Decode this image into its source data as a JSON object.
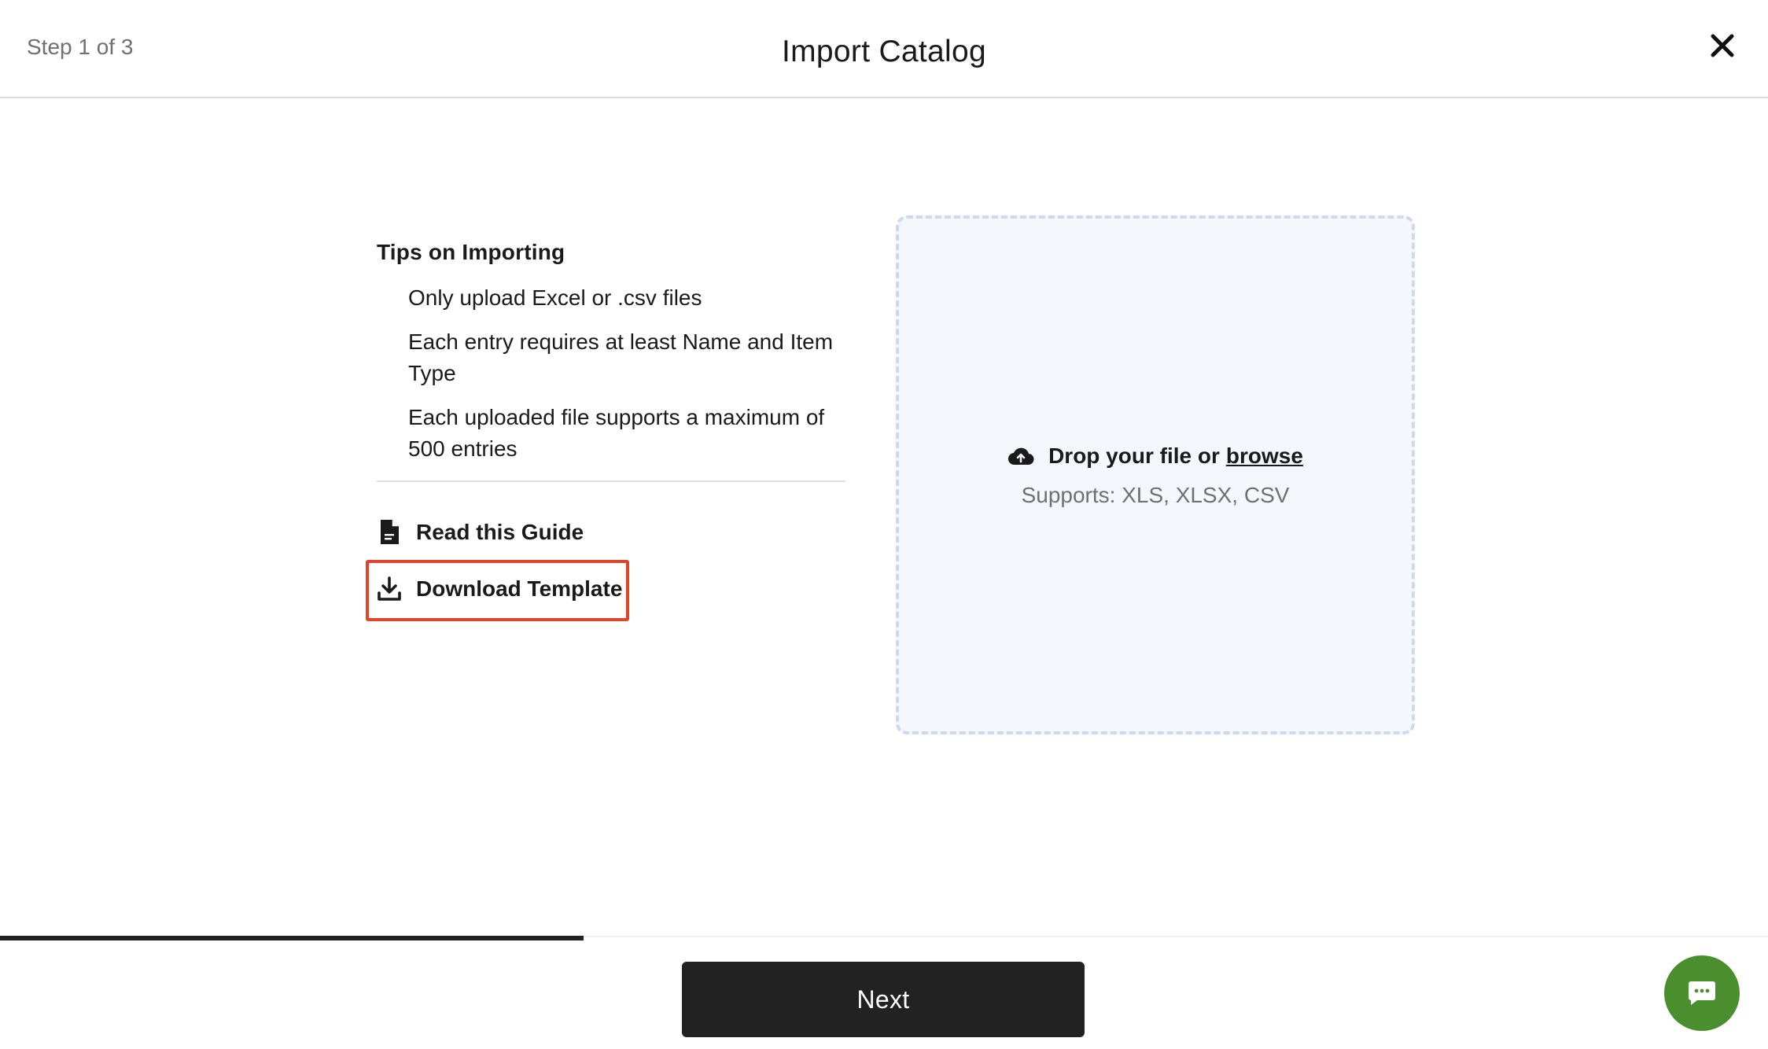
{
  "header": {
    "step": "Step 1 of 3",
    "title": "Import Catalog"
  },
  "tips": {
    "title": "Tips on Importing",
    "items": [
      "Only upload Excel or .csv files",
      "Each entry requires at least Name and Item Type",
      "Each uploaded file supports a maximum of 500 entries"
    ]
  },
  "actions": {
    "guide_label": "Read this Guide",
    "download_label": "Download Template"
  },
  "dropzone": {
    "prompt": "Drop your file or",
    "browse_label": "browse",
    "supports": "Supports: XLS, XLSX, CSV"
  },
  "footer": {
    "progress_fraction": 0.33,
    "next_label": "Next"
  },
  "icons": {
    "close": "close-icon",
    "guide": "document-icon",
    "download": "download-icon",
    "upload": "cloud-upload-icon",
    "chat": "chat-icon"
  },
  "colors": {
    "highlight": "#e0452a",
    "chat": "#4a8e2e",
    "button": "#222222",
    "dropzone_bg": "#f4f7fc"
  }
}
